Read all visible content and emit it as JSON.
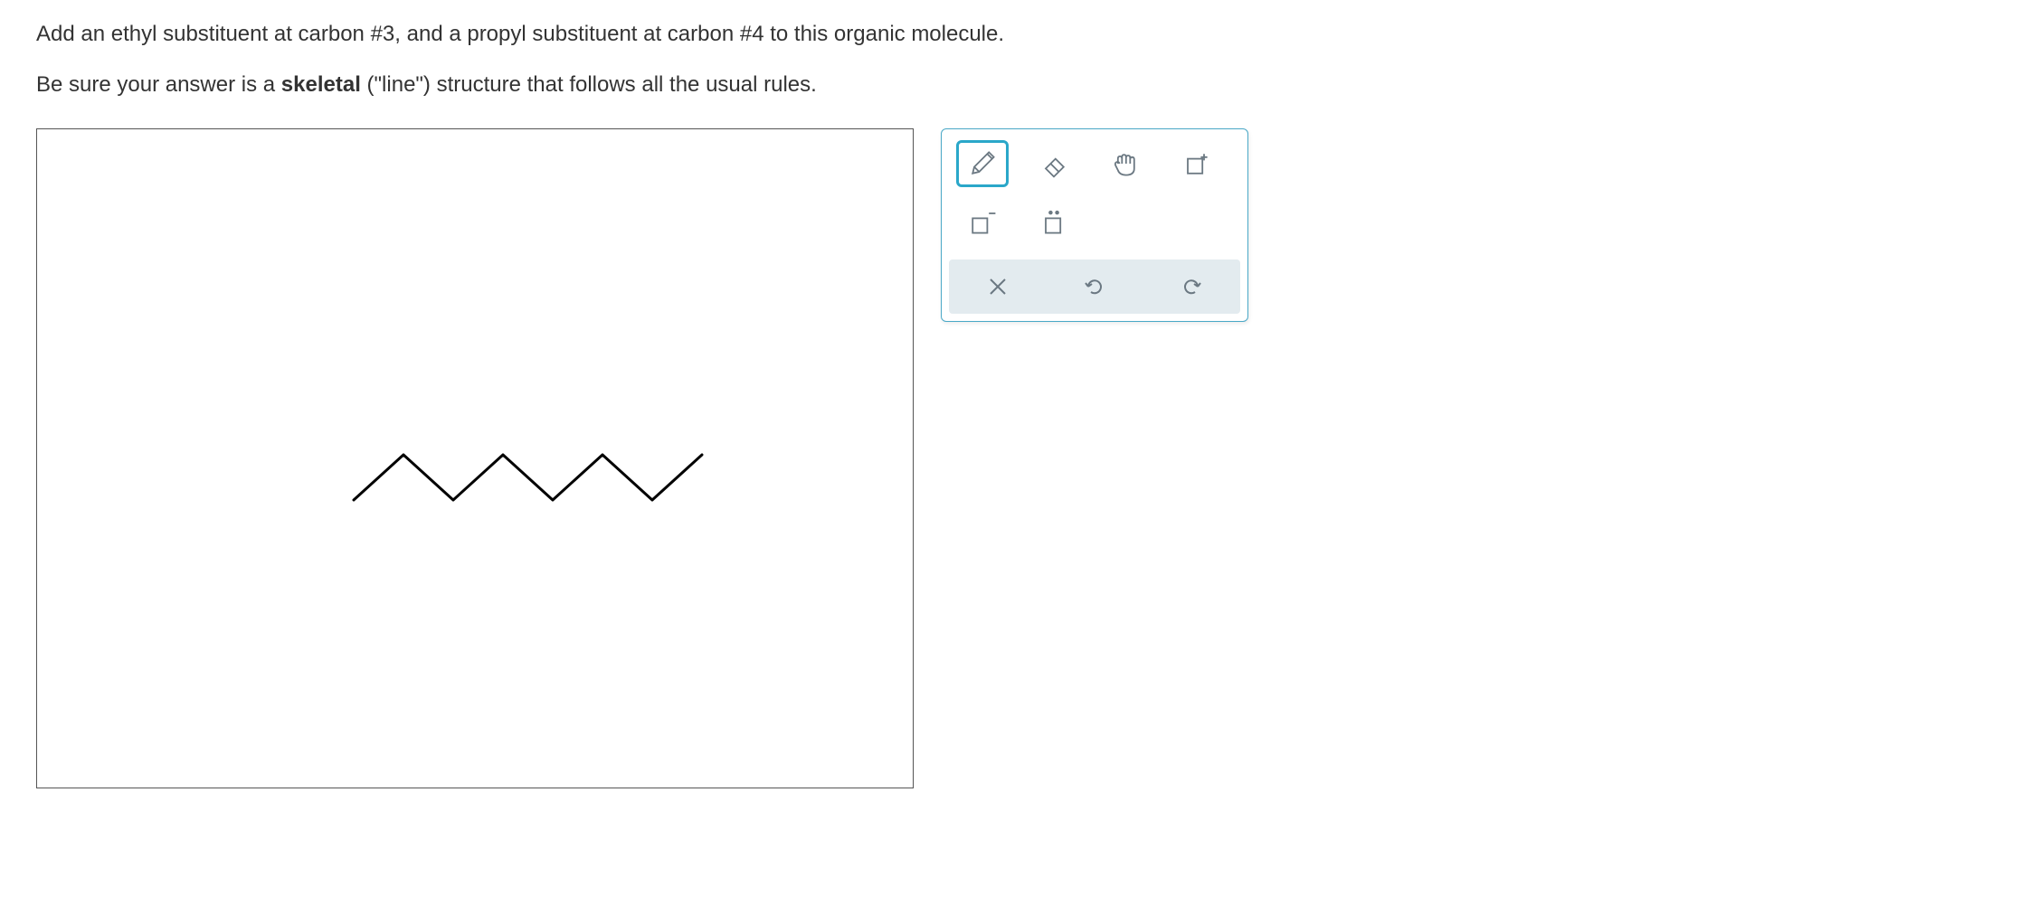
{
  "question": {
    "line1_pre": "Add an ethyl substituent at carbon #",
    "carbon1": "3",
    "line1_mid": ", and a propyl substituent at carbon #",
    "carbon2": "4",
    "line1_post": " to this organic molecule.",
    "line2_pre": "Be sure your answer is a ",
    "line2_bold": "skeletal",
    "line2_post": " (\"line\") structure that follows all the usual rules."
  },
  "tools": {
    "pencil": "pencil-icon",
    "eraser": "eraser-icon",
    "grab": "grab-icon",
    "selectplus": "selection-plus-icon",
    "negcharge": "negative-charge-icon",
    "lonepair": "lone-pair-icon"
  },
  "actions": {
    "clear": "clear-icon",
    "undo": "undo-icon",
    "redo": "redo-icon"
  }
}
